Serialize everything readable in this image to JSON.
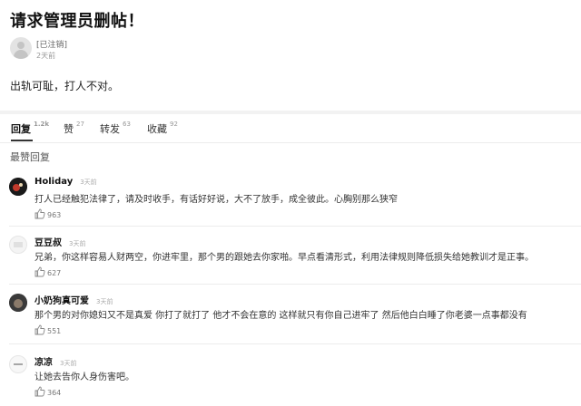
{
  "post": {
    "title": "请求管理员删帖！",
    "author": "[已注销]",
    "time": "2天前",
    "body": "出轨可耻，打人不对。"
  },
  "tabs": [
    {
      "label": "回复",
      "count": "1.2k"
    },
    {
      "label": "赞",
      "count": "27"
    },
    {
      "label": "转发",
      "count": "63"
    },
    {
      "label": "收藏",
      "count": "92"
    }
  ],
  "section": {
    "label": "最赞回复"
  },
  "comments": [
    {
      "name": "Holiday",
      "time": "3天前",
      "text": "打人已经触犯法律了，请及时收手，有话好好说，大不了放手，成全彼此。心胸别那么狭窄",
      "likes": "963",
      "avatar_color": "#1a1a1a"
    },
    {
      "name": "豆豆叔",
      "time": "3天前",
      "text": "兄弟，你这样容易人财两空，你进牢里，那个男的跟她去你家啪。早点看清形式，利用法律规则降低损失给她教训才是正事。",
      "likes": "627",
      "avatar_color": "#f4f4f4"
    },
    {
      "name": "小奶狗真可爱",
      "time": "3天前",
      "text": "那个男的对你媳妇又不是真爱  你打了就打了 他才不会在意的  这样就只有你自己进牢了  然后他白白睡了你老婆一点事都没有",
      "likes": "551",
      "avatar_color": "#3a3a3a"
    },
    {
      "name": "凉凉",
      "time": "3天前",
      "text": "让她去告你人身伤害吧。",
      "likes": "364",
      "avatar_color": "#f7f7f7"
    }
  ]
}
